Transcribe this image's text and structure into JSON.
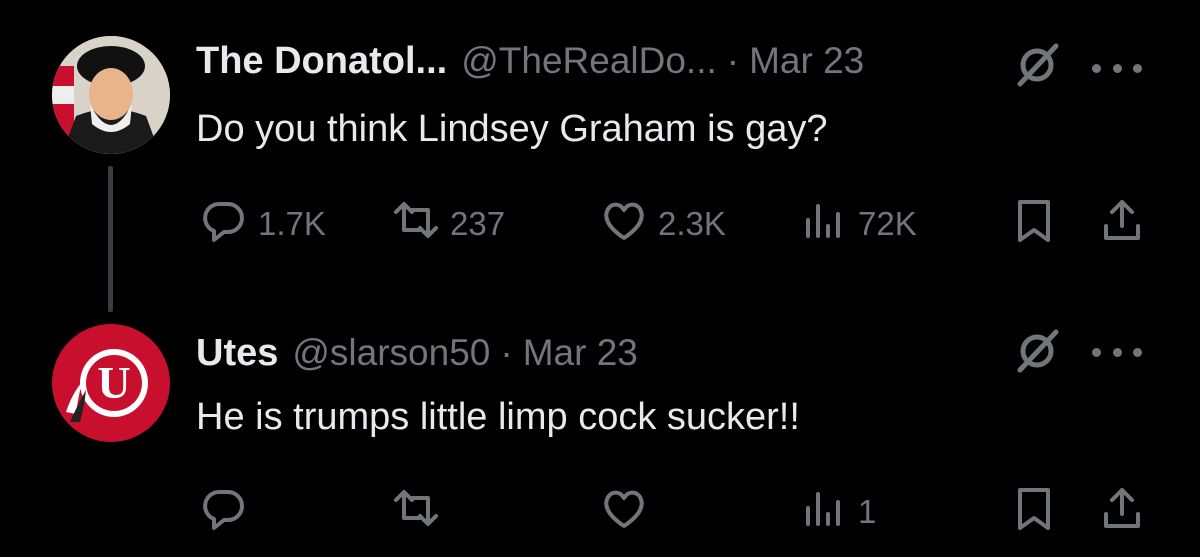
{
  "tweets": [
    {
      "display_name": "The Donatol...",
      "handle": "@TheRealDo...",
      "separator": "·",
      "date": "Mar 23",
      "text": "Do you think Lindsey Graham is gay?",
      "replies": "1.7K",
      "reposts": "237",
      "likes": "2.3K",
      "views": "72K"
    },
    {
      "display_name": "Utes",
      "handle": "@slarson50",
      "separator": "·",
      "date": "Mar 23",
      "text": "He is trumps little limp cock sucker!!",
      "replies": "",
      "reposts": "",
      "likes": "",
      "views": "1"
    }
  ],
  "icons": {
    "reply": "reply-icon",
    "repost": "repost-icon",
    "like": "like-icon",
    "views": "views-icon",
    "bookmark": "bookmark-icon",
    "share": "share-icon",
    "grok": "grok-icon",
    "more": "more-icon"
  },
  "colors": {
    "background": "#000000",
    "text": "#e7e9ea",
    "muted": "#71767b",
    "thread_line": "#3a3d40",
    "utes_red": "#c8102e"
  }
}
